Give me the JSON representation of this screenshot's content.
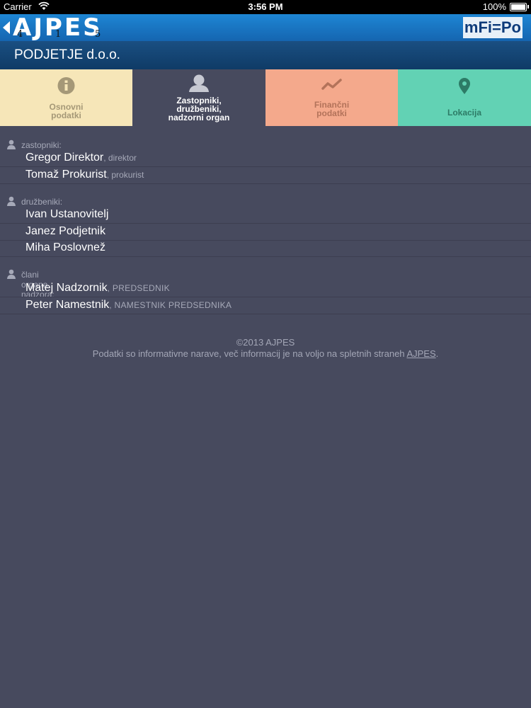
{
  "status_bar": {
    "carrier": "Carrier",
    "time": "3:56 PM",
    "battery": "100%"
  },
  "header": {
    "logo_text": "AJPES",
    "logo_digits": [
      "4",
      "1",
      "5"
    ],
    "brand_right": "mFi=Po"
  },
  "company": {
    "title": "PODJETJE d.o.o."
  },
  "tabs": [
    {
      "label_lines": [
        "Osnovni",
        "podatki"
      ],
      "icon": "info-icon",
      "color": "#f6e6b8",
      "active": false
    },
    {
      "label_lines": [
        "Zastopniki,",
        "družbeniki,",
        "nadzorni organ"
      ],
      "icon": "person-icon",
      "color": "#474a5e",
      "active": true
    },
    {
      "label_lines": [
        "Finančni",
        "podatki"
      ],
      "icon": "trend-icon",
      "color": "#f4a98c",
      "active": false
    },
    {
      "label_lines": [
        "Lokacija"
      ],
      "icon": "map-pin-icon",
      "color": "#62d2b4",
      "active": false
    }
  ],
  "sections": [
    {
      "heading": "zastopniki:",
      "people": [
        {
          "name": "Gregor Direktor",
          "role": ", direktor"
        },
        {
          "name": "Tomaž Prokurist",
          "role": ", prokurist"
        }
      ]
    },
    {
      "heading": "družbeniki:",
      "people": [
        {
          "name": "Ivan Ustanovitelj",
          "role": ""
        },
        {
          "name": "Janez Podjetnik",
          "role": ""
        },
        {
          "name": "Miha Poslovnež",
          "role": ""
        }
      ]
    },
    {
      "heading": "člani organa nadzora:",
      "people": [
        {
          "name": "Matej Nadzornik",
          "role": ", PREDSEDNIK"
        },
        {
          "name": "Peter Namestnik",
          "role": ", NAMESTNIK PREDSEDNIKA"
        }
      ]
    }
  ],
  "footer": {
    "copyright": "©2013 AJPES",
    "note_before_link": "Podatki so informativne narave, več informacij je na voljo na spletnih straneh ",
    "link_text": "AJPES",
    "note_after_link": "."
  }
}
